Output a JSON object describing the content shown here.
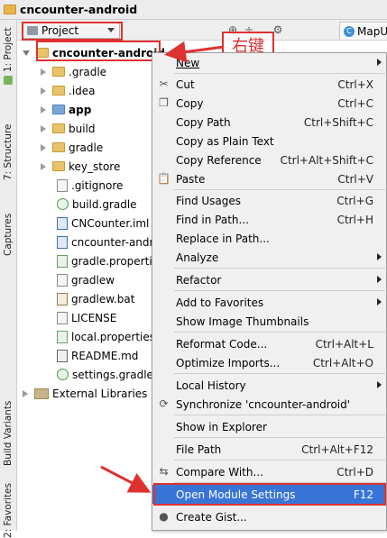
{
  "breadcrumb": {
    "title": "cncounter-android"
  },
  "left_tabs": [
    "1: Project",
    "7: Structure",
    "Captures",
    "Build Variants",
    "2: Favorites"
  ],
  "toolbar": {
    "project_view": "Project",
    "editor_tab": "MapUtil."
  },
  "tree": {
    "root": "cncounter-android",
    "items": [
      {
        "label": "gradle",
        "prefix": ".",
        "type": "folder"
      },
      {
        "label": "idea",
        "prefix": ".",
        "type": "folder"
      },
      {
        "label": "app",
        "prefix": "",
        "type": "module"
      },
      {
        "label": "build",
        "prefix": "",
        "type": "folder"
      },
      {
        "label": "gradle",
        "prefix": "",
        "type": "folder"
      },
      {
        "label": "key_store",
        "prefix": "",
        "type": "folder"
      },
      {
        "label": ".gitignore",
        "type": "file"
      },
      {
        "label": "build.gradle",
        "type": "gradle"
      },
      {
        "label": "CNCounter.iml",
        "type": "iml"
      },
      {
        "label": "cncounter-andr",
        "type": "iml"
      },
      {
        "label": "gradle.properti",
        "type": "prop"
      },
      {
        "label": "gradlew",
        "type": "file"
      },
      {
        "label": "gradlew.bat",
        "type": "bat"
      },
      {
        "label": "LICENSE",
        "type": "file"
      },
      {
        "label": "local.properties",
        "type": "prop"
      },
      {
        "label": "README.md",
        "type": "md"
      },
      {
        "label": "settings.gradle",
        "type": "gradle"
      }
    ],
    "external": "External Libraries"
  },
  "annotation": "右键",
  "menu": [
    {
      "label": "New",
      "shortcut": "",
      "sub": true,
      "icon": ""
    },
    {
      "label": "Cut",
      "shortcut": "Ctrl+X",
      "icon": "scissors-icon"
    },
    {
      "label": "Copy",
      "shortcut": "Ctrl+C",
      "icon": "copy-icon"
    },
    {
      "label": "Copy Path",
      "shortcut": "Ctrl+Shift+C",
      "icon": ""
    },
    {
      "label": "Copy as Plain Text",
      "shortcut": "",
      "icon": ""
    },
    {
      "label": "Copy Reference",
      "shortcut": "Ctrl+Alt+Shift+C",
      "icon": ""
    },
    {
      "label": "Paste",
      "shortcut": "Ctrl+V",
      "icon": "paste-icon"
    },
    {
      "label": "Find Usages",
      "shortcut": "Ctrl+G",
      "icon": ""
    },
    {
      "label": "Find in Path...",
      "shortcut": "Ctrl+H",
      "icon": ""
    },
    {
      "label": "Replace in Path...",
      "shortcut": "",
      "icon": ""
    },
    {
      "label": "Analyze",
      "shortcut": "",
      "sub": true,
      "icon": ""
    },
    {
      "label": "Refactor",
      "shortcut": "",
      "sub": true,
      "icon": ""
    },
    {
      "label": "Add to Favorites",
      "shortcut": "",
      "sub": true,
      "icon": ""
    },
    {
      "label": "Show Image Thumbnails",
      "shortcut": "",
      "icon": ""
    },
    {
      "label": "Reformat Code...",
      "shortcut": "Ctrl+Alt+L",
      "icon": ""
    },
    {
      "label": "Optimize Imports...",
      "shortcut": "Ctrl+Alt+O",
      "icon": ""
    },
    {
      "label": "Local History",
      "shortcut": "",
      "sub": true,
      "icon": ""
    },
    {
      "label": "Synchronize 'cncounter-android'",
      "shortcut": "",
      "icon": "sync-icon"
    },
    {
      "label": "Show in Explorer",
      "shortcut": "",
      "icon": ""
    },
    {
      "label": "File Path",
      "shortcut": "Ctrl+Alt+F12",
      "icon": ""
    },
    {
      "label": "Compare With...",
      "shortcut": "Ctrl+D",
      "icon": "compare-icon"
    },
    {
      "label": "Open Module Settings",
      "shortcut": "F12",
      "icon": ""
    },
    {
      "label": "Create Gist...",
      "shortcut": "",
      "icon": "github-icon"
    }
  ]
}
